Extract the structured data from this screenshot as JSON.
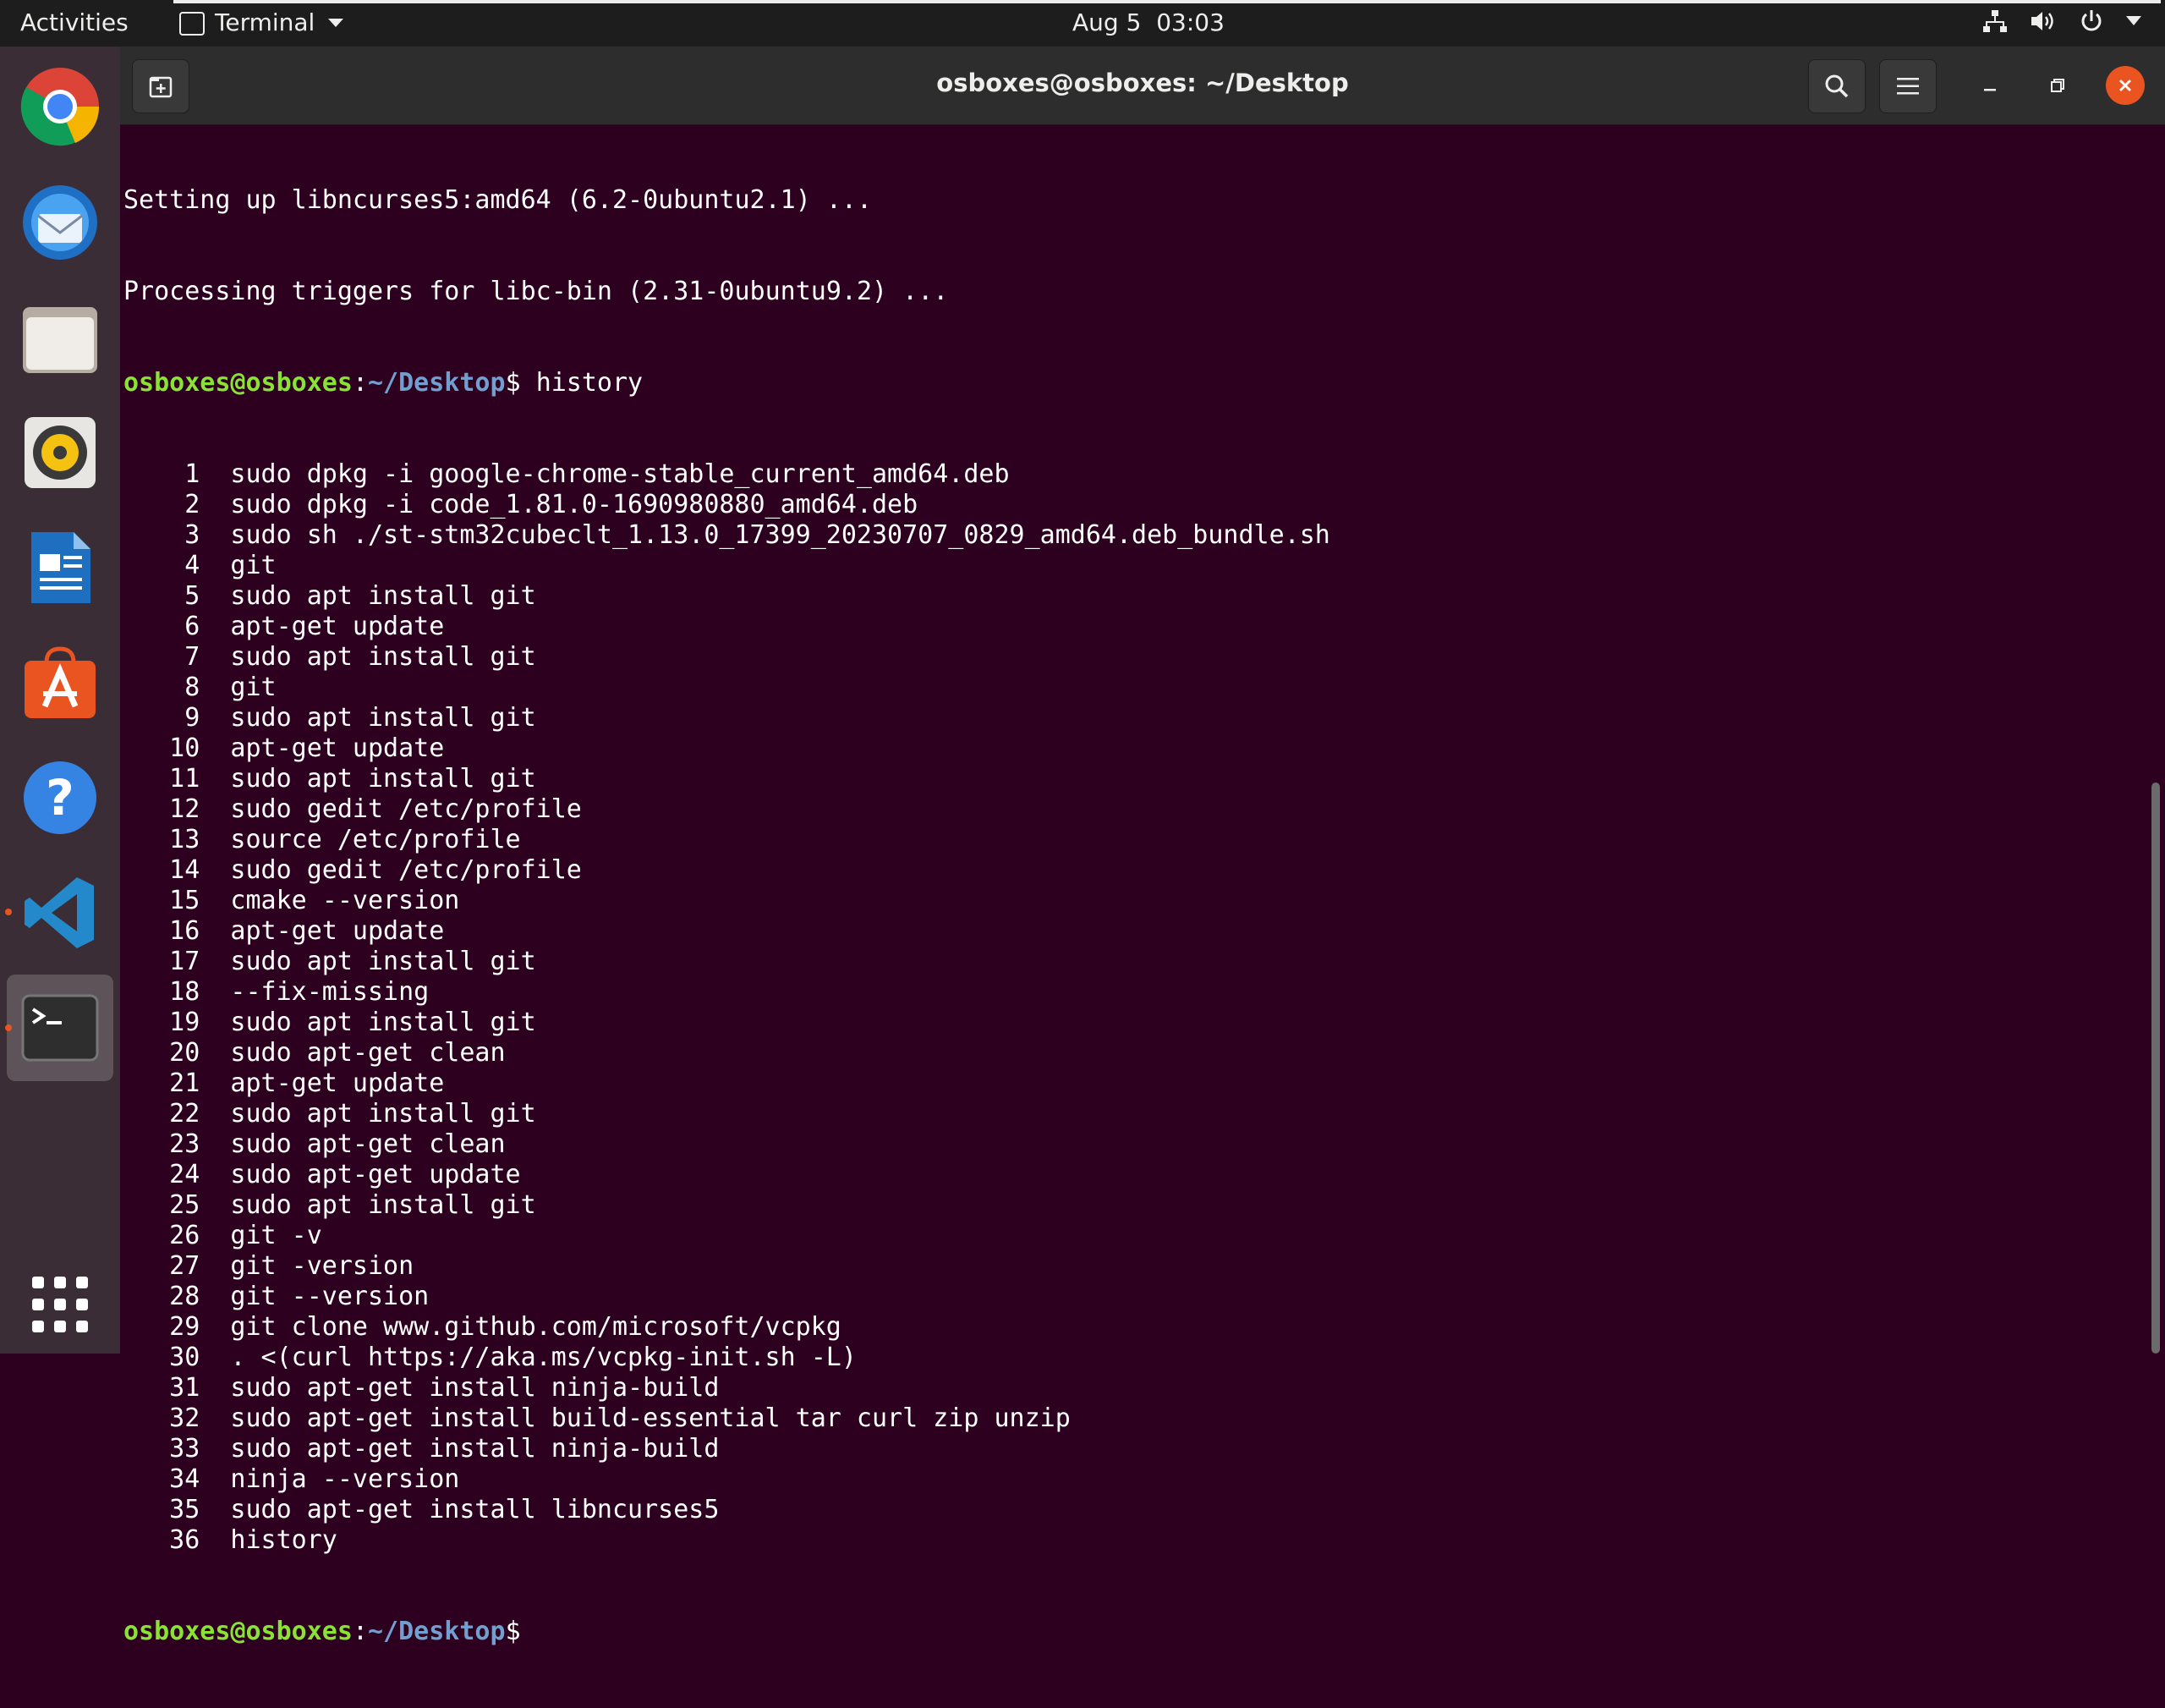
{
  "topbar": {
    "activities": "Activities",
    "app_name": "Terminal",
    "clock": "Aug 5  03:03"
  },
  "dock": {
    "items": [
      {
        "name": "chrome"
      },
      {
        "name": "thunderbird"
      },
      {
        "name": "files"
      },
      {
        "name": "rhythmbox"
      },
      {
        "name": "libreoffice-writer"
      },
      {
        "name": "ubuntu-software"
      },
      {
        "name": "help"
      },
      {
        "name": "vscode",
        "running": true
      },
      {
        "name": "terminal",
        "running": true,
        "active": true
      }
    ]
  },
  "window": {
    "title": "osboxes@osboxes: ~/Desktop"
  },
  "terminal": {
    "prompt_user": "osboxes@osboxes",
    "prompt_sep": ":",
    "prompt_path": "~/Desktop",
    "prompt_symbol": "$ ",
    "pre_lines": [
      "Setting up libncurses5:amd64 (6.2-0ubuntu2.1) ...",
      "Processing triggers for libc-bin (2.31-0ubuntu9.2) ..."
    ],
    "command": "history",
    "history": [
      {
        "num": "1",
        "cmd": "sudo dpkg -i google-chrome-stable_current_amd64.deb"
      },
      {
        "num": "2",
        "cmd": "sudo dpkg -i code_1.81.0-1690980880_amd64.deb"
      },
      {
        "num": "3",
        "cmd": "sudo sh ./st-stm32cubeclt_1.13.0_17399_20230707_0829_amd64.deb_bundle.sh"
      },
      {
        "num": "4",
        "cmd": "git"
      },
      {
        "num": "5",
        "cmd": "sudo apt install git"
      },
      {
        "num": "6",
        "cmd": "apt-get update"
      },
      {
        "num": "7",
        "cmd": "sudo apt install git"
      },
      {
        "num": "8",
        "cmd": "git"
      },
      {
        "num": "9",
        "cmd": "sudo apt install git"
      },
      {
        "num": "10",
        "cmd": "apt-get update"
      },
      {
        "num": "11",
        "cmd": "sudo apt install git"
      },
      {
        "num": "12",
        "cmd": "sudo gedit /etc/profile"
      },
      {
        "num": "13",
        "cmd": "source /etc/profile"
      },
      {
        "num": "14",
        "cmd": "sudo gedit /etc/profile"
      },
      {
        "num": "15",
        "cmd": "cmake --version"
      },
      {
        "num": "16",
        "cmd": "apt-get update"
      },
      {
        "num": "17",
        "cmd": "sudo apt install git"
      },
      {
        "num": "18",
        "cmd": "--fix-missing"
      },
      {
        "num": "19",
        "cmd": "sudo apt install git"
      },
      {
        "num": "20",
        "cmd": "sudo apt-get clean"
      },
      {
        "num": "21",
        "cmd": "apt-get update"
      },
      {
        "num": "22",
        "cmd": "sudo apt install git"
      },
      {
        "num": "23",
        "cmd": "sudo apt-get clean"
      },
      {
        "num": "24",
        "cmd": "sudo apt-get update"
      },
      {
        "num": "25",
        "cmd": "sudo apt install git"
      },
      {
        "num": "26",
        "cmd": "git -v"
      },
      {
        "num": "27",
        "cmd": "git -version"
      },
      {
        "num": "28",
        "cmd": "git --version"
      },
      {
        "num": "29",
        "cmd": "git clone www.github.com/microsoft/vcpkg"
      },
      {
        "num": "30",
        "cmd": ". <(curl https://aka.ms/vcpkg-init.sh -L)"
      },
      {
        "num": "31",
        "cmd": "sudo apt-get install ninja-build"
      },
      {
        "num": "32",
        "cmd": "sudo apt-get install build-essential tar curl zip unzip"
      },
      {
        "num": "33",
        "cmd": "sudo apt-get install ninja-build"
      },
      {
        "num": "34",
        "cmd": "ninja --version"
      },
      {
        "num": "35",
        "cmd": "sudo apt-get install libncurses5"
      },
      {
        "num": "36",
        "cmd": "history"
      }
    ]
  },
  "colors": {
    "terminal_bg": "#2c001e",
    "prompt_user": "#8ae234",
    "prompt_path": "#729fcf",
    "accent": "#e95420"
  }
}
